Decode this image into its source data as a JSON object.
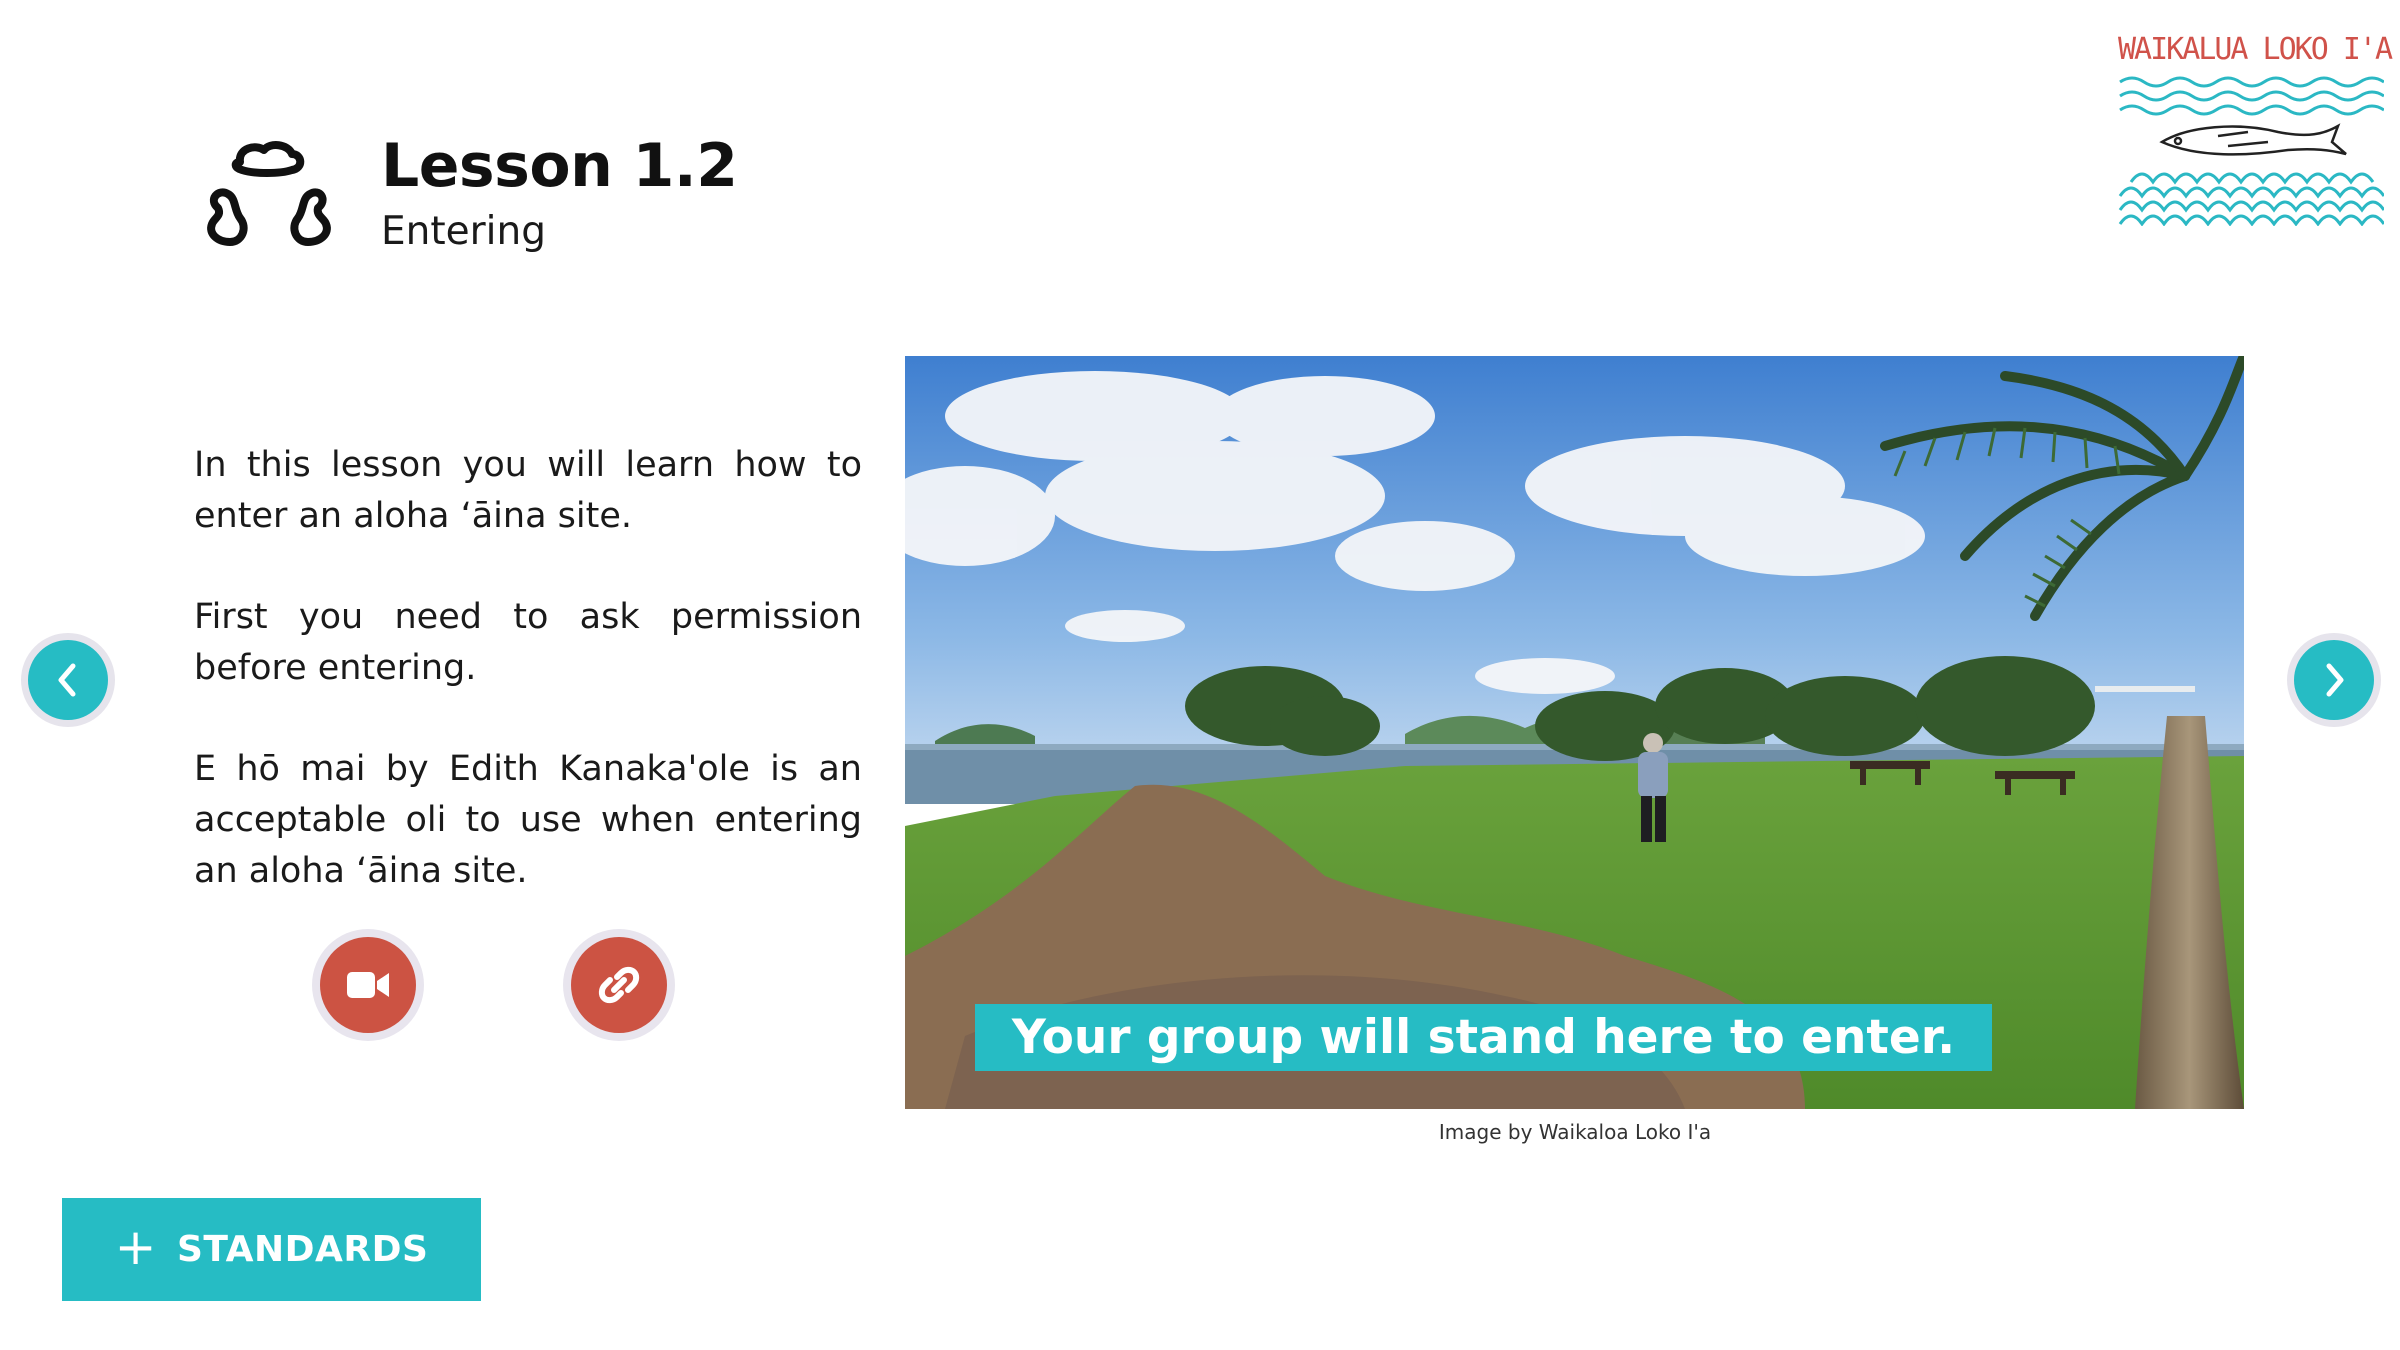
{
  "header": {
    "title": "Lesson 1.2",
    "subtitle": "Entering",
    "lesson_icon": "three-stones-icon"
  },
  "logo": {
    "text": "WAIKALUA LOKO I'A",
    "icon": "fish-waves-logo",
    "colors": {
      "text": "#d0524a",
      "waves": "#2bb8c4",
      "fish": "#222222"
    }
  },
  "intro": {
    "paragraphs": [
      "In this lesson you will learn how to enter an aloha ʻāina site.",
      "First you need to ask permission before entering.",
      "E hō mai by Edith Kanaka'ole is an acceptable oli to use when entering an aloha ʻāina site."
    ]
  },
  "actions": {
    "video_icon": "video-camera-icon",
    "link_icon": "link-icon"
  },
  "navigation": {
    "prev_icon": "chevron-left-icon",
    "next_icon": "chevron-right-icon"
  },
  "photo": {
    "caption": "Your group will stand here to enter.",
    "credit": "Image by Waikaloa Loko I'a"
  },
  "standards": {
    "label": "STANDARDS",
    "icon": "plus-icon"
  },
  "colors": {
    "accent": "#26bcc4",
    "action": "#cc5343"
  }
}
